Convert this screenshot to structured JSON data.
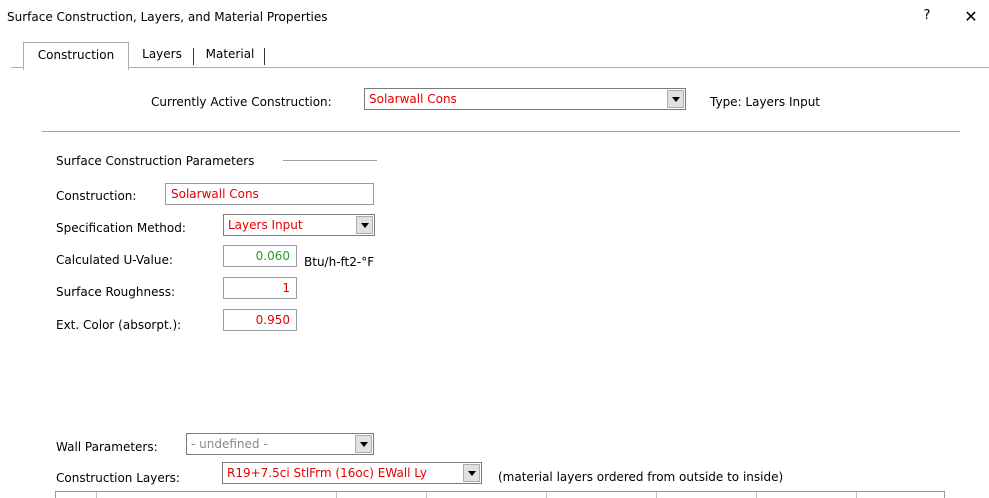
{
  "window": {
    "title": "Surface Construction, Layers, and Material Properties",
    "help_glyph": "?",
    "close_glyph": "✕"
  },
  "tabs": [
    {
      "label": "Construction",
      "active": true
    },
    {
      "label": "Layers",
      "active": false
    },
    {
      "label": "Material",
      "active": false
    }
  ],
  "active_construction": {
    "label": "Currently Active Construction:",
    "value": "Solarwall Cons",
    "type_text": "Type: Layers Input"
  },
  "params": {
    "section_title": "Surface Construction Parameters",
    "construction_label": "Construction:",
    "construction_value": "Solarwall Cons",
    "spec_method_label": "Specification Method:",
    "spec_method_value": "Layers Input",
    "u_value_label": "Calculated U-Value:",
    "u_value": "0.060",
    "u_value_units": "Btu/h-ft2-°F",
    "roughness_label": "Surface Roughness:",
    "roughness_value": "1",
    "ext_color_label": "Ext. Color (absorpt.):",
    "ext_color_value": "0.950"
  },
  "wall": {
    "label": "Wall Parameters:",
    "value": "- undefined -"
  },
  "layers": {
    "label": "Construction Layers:",
    "value": "R19+7.5ci StlFrm (16oc) EWall Ly",
    "note": "(material layers ordered from outside to inside)"
  },
  "colors": {
    "value_red": "#e60000",
    "value_green": "#2e9a2e"
  }
}
